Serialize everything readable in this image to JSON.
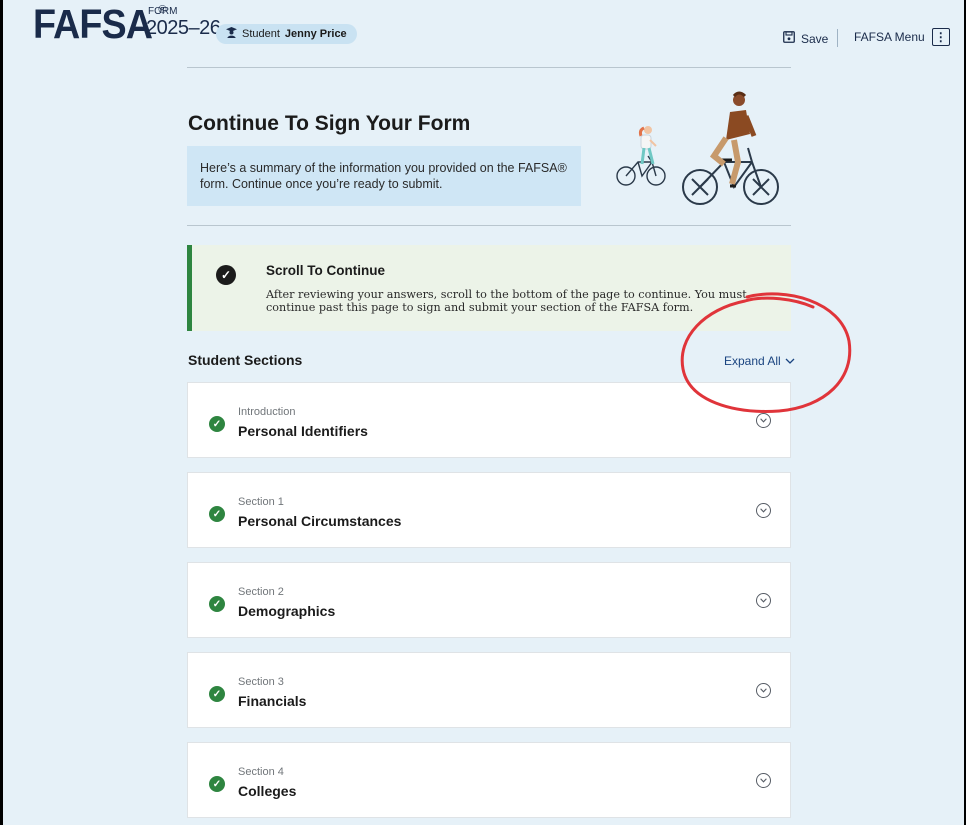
{
  "header": {
    "logo_text": "FAFSA",
    "logo_mark": "®",
    "form_label": "FORM",
    "form_year": "2025–26",
    "student_prefix": "Student",
    "student_name": "Jenny Price",
    "save_label": "Save",
    "menu_label": "FAFSA Menu",
    "menu_icon_glyph": "⋮"
  },
  "intro": {
    "title": "Continue To Sign Your Form",
    "summary": "Here’s a summary of the information you provided on the FAFSA® form. Continue once you’re ready to submit."
  },
  "alert": {
    "title": "Scroll To Continue",
    "body": "After reviewing your answers, scroll to the bottom of the page to continue. You must continue past this page to sign and submit your section of the FAFSA form."
  },
  "sections": {
    "heading": "Student Sections",
    "expand_label": "Expand All",
    "items": [
      {
        "sub": "Introduction",
        "name": "Personal Identifiers"
      },
      {
        "sub": "Section 1",
        "name": "Personal Circumstances"
      },
      {
        "sub": "Section 2",
        "name": "Demographics"
      },
      {
        "sub": "Section 3",
        "name": "Financials"
      },
      {
        "sub": "Section 4",
        "name": "Colleges"
      }
    ]
  },
  "colors": {
    "page_bg": "#e6f1f8",
    "brand_navy": "#1a2b4a",
    "success_green": "#2e8540",
    "link_blue": "#1a4480",
    "annotation_red": "#e0343a"
  },
  "icons": {
    "student": "student-icon",
    "save": "save-icon",
    "menu": "kebab-menu-icon",
    "check": "check-circle-icon",
    "expand": "chevron-down-icon",
    "card_toggle": "chevron-circle-down-icon"
  }
}
